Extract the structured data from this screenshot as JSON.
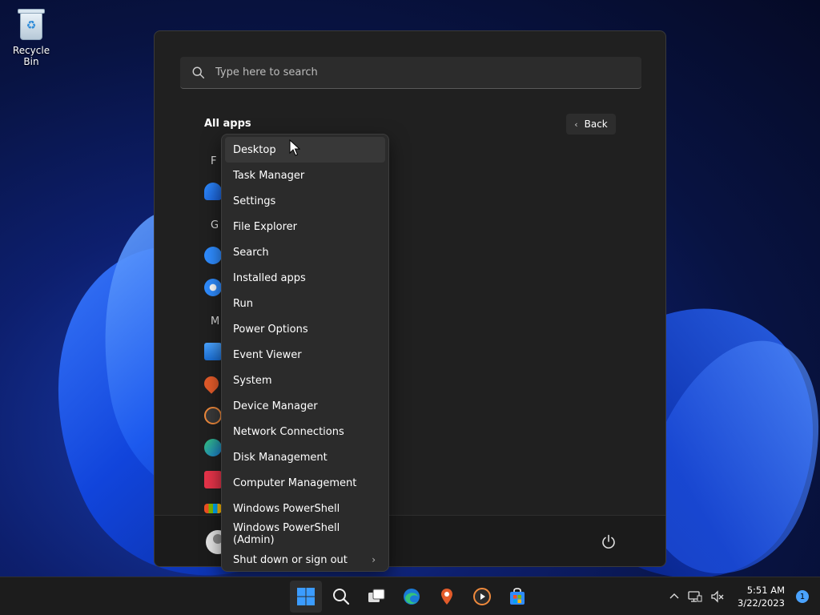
{
  "desktop": {
    "recycle_bin_label": "Recycle Bin"
  },
  "start_menu": {
    "search_placeholder": "Type here to search",
    "all_apps_title": "All apps",
    "back_label": "Back",
    "app_letters": [
      "F",
      "G",
      "M"
    ]
  },
  "context_menu": {
    "items": [
      "Desktop",
      "Task Manager",
      "Settings",
      "File Explorer",
      "Search",
      "Installed apps",
      "Run",
      "Power Options",
      "Event Viewer",
      "System",
      "Device Manager",
      "Network Connections",
      "Disk Management",
      "Computer Management",
      "Windows PowerShell",
      "Windows PowerShell (Admin)",
      "Shut down or sign out"
    ],
    "hovered_index": 0
  },
  "taskbar": {
    "time": "5:51 AM",
    "date": "3/22/2023",
    "notification_count": "1"
  },
  "colors": {
    "accent": "#4aa3ff",
    "menu_bg": "#2b2b2b",
    "start_bg": "#202020"
  }
}
